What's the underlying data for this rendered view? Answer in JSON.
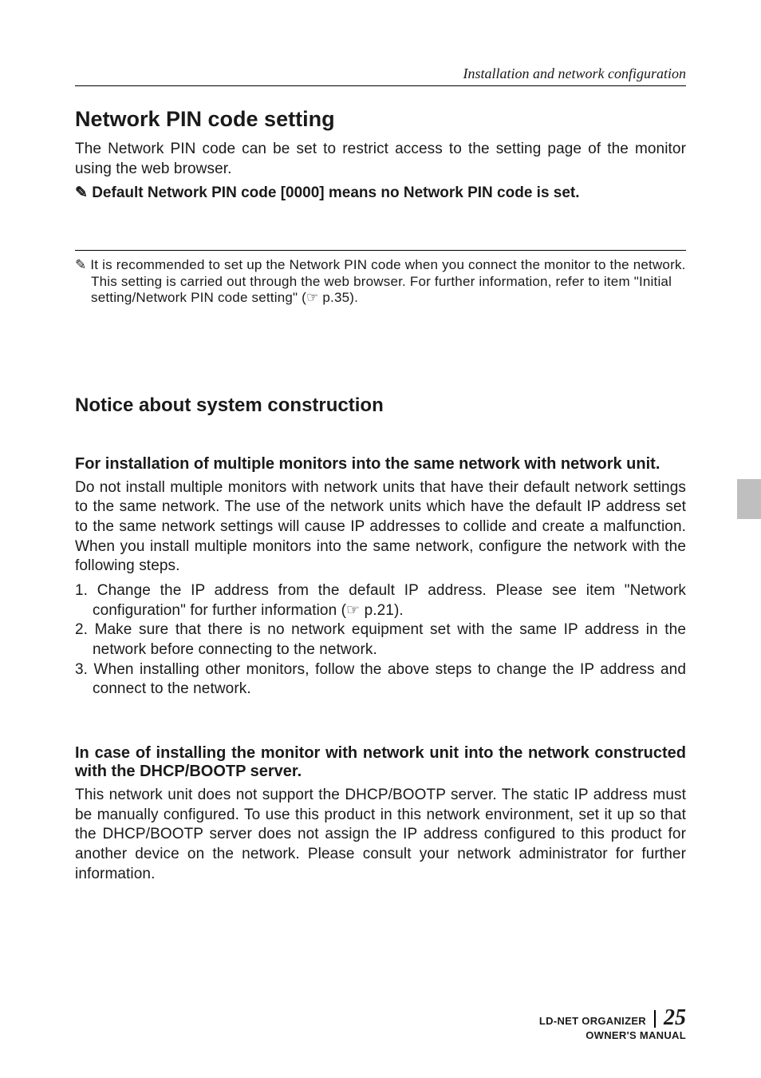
{
  "runningHead": "Installation and network configuration",
  "section1": {
    "title": "Network PIN code setting",
    "intro": "The Network PIN code can be set to restrict access to the setting page of the monitor using the web browser.",
    "emphasis": "✎ Default Network PIN code [0000] means no Network PIN code is set.",
    "note": "✎ It is recommended to set up the Network PIN code when you connect the monitor to the network. This setting is carried out through the web browser. For further information, refer to item \"Initial setting/Network PIN code setting\" (☞ p.35)."
  },
  "section2": {
    "title": "Notice about system construction",
    "sub1": {
      "heading": "For installation of multiple monitors into the same network with network unit.",
      "body": "Do not install multiple monitors with network units that have their default network settings to the same network. The use of the network units which have the default IP address set to the same network settings will cause IP addresses to collide and create a malfunction. When you install multiple monitors into the same network, configure the network with the following steps.",
      "steps": [
        "1. Change the IP address from the default IP address. Please see item \"Network configuration\" for further information (☞ p.21).",
        "2. Make sure that there is no network equipment set with the same IP address in the network before connecting to the network.",
        "3. When installing other monitors, follow the above steps to change the IP address and connect to the network."
      ]
    },
    "sub2": {
      "heading": "In case of installing the monitor with network unit into the network constructed with the DHCP/BOOTP server.",
      "body": "This network unit does not support the DHCP/BOOTP server. The static IP address must be manually configured. To use this product in this network environment, set it up so that the DHCP/BOOTP server does not assign the IP address configured to this product for another device on the network. Please consult your network administrator for further information."
    }
  },
  "footer": {
    "brand": "LD-NET ORGANIZER",
    "sub": "OWNER'S MANUAL",
    "page": "25"
  }
}
